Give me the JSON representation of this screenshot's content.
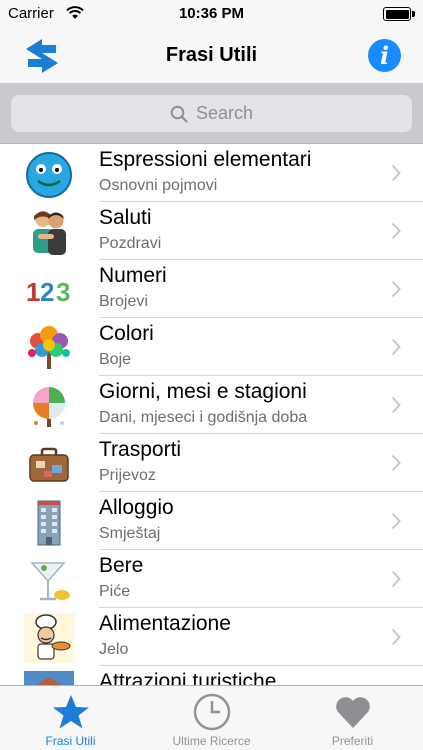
{
  "status": {
    "carrier": "Carrier",
    "time": "10:36 PM"
  },
  "nav": {
    "title": "Frasi Utili",
    "left_icon": "swap-arrows-icon",
    "right_icon": "info-icon",
    "info_glyph": "i"
  },
  "search": {
    "placeholder": "Search"
  },
  "list": {
    "items": [
      {
        "title": "Espressioni elementari",
        "subtitle": "Osnovni pojmovi",
        "icon": "smiley-face-icon"
      },
      {
        "title": "Saluti",
        "subtitle": "Pozdravi",
        "icon": "hug-icon"
      },
      {
        "title": "Numeri",
        "subtitle": "Brojevi",
        "icon": "numbers-icon",
        "icon_text": [
          "1",
          "2",
          "3"
        ]
      },
      {
        "title": "Colori",
        "subtitle": "Boje",
        "icon": "color-tree-icon"
      },
      {
        "title": "Giorni, mesi e stagioni",
        "subtitle": "Dani, mjeseci i godišnja doba",
        "icon": "seasons-tree-icon"
      },
      {
        "title": "Trasporti",
        "subtitle": "Prijevoz",
        "icon": "suitcase-icon"
      },
      {
        "title": "Alloggio",
        "subtitle": "Smještaj",
        "icon": "building-icon"
      },
      {
        "title": "Bere",
        "subtitle": "Piće",
        "icon": "cocktail-icon"
      },
      {
        "title": "Alimentazione",
        "subtitle": "Jelo",
        "icon": "chef-icon"
      },
      {
        "title": "Attrazioni turistiche",
        "subtitle": "",
        "icon": "sightseeing-icon"
      }
    ]
  },
  "tabs": [
    {
      "label": "Frasi Utili",
      "icon": "star-icon",
      "active": true
    },
    {
      "label": "Ultime Ricerce",
      "icon": "clock-icon",
      "active": false
    },
    {
      "label": "Preferiti",
      "icon": "heart-icon",
      "active": false
    }
  ],
  "colors": {
    "accent": "#1a8cff",
    "tab_active": "#1a7fd4",
    "tab_inactive": "#929292"
  }
}
